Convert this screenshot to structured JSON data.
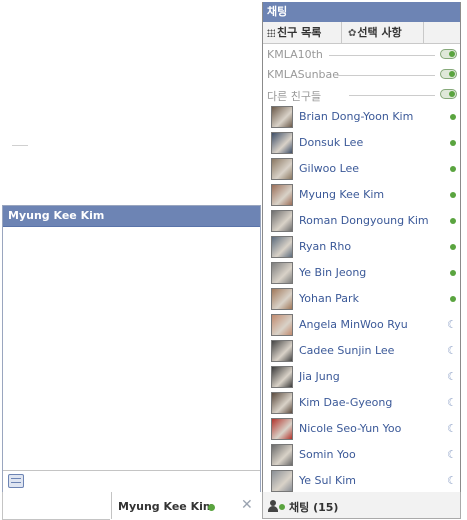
{
  "buddy_list": {
    "title": "채팅",
    "toolbar": {
      "friends_list_label": "친구 목록",
      "options_label": "선택 사항"
    },
    "groups": [
      {
        "label": "KMLA10th",
        "enabled": true
      },
      {
        "label": "KMLASunbae",
        "enabled": true
      },
      {
        "label": "다른 친구들",
        "enabled": true
      }
    ],
    "friends": [
      {
        "name": "Brian Dong-Yoon Kim",
        "status": "online",
        "avatar_color": "#6b5a4a"
      },
      {
        "name": "Donsuk Lee",
        "status": "online",
        "avatar_color": "#3d4e67"
      },
      {
        "name": "Gilwoo Lee",
        "status": "online",
        "avatar_color": "#8a7862"
      },
      {
        "name": "Myung Kee Kim",
        "status": "online",
        "avatar_color": "#9a6e58"
      },
      {
        "name": "Roman Dongyoung Kim",
        "status": "online",
        "avatar_color": "#6e6e6e"
      },
      {
        "name": "Ryan Rho",
        "status": "online",
        "avatar_color": "#5c6b7c"
      },
      {
        "name": "Ye Bin Jeong",
        "status": "online",
        "avatar_color": "#7d7d7d"
      },
      {
        "name": "Yohan Park",
        "status": "online",
        "avatar_color": "#a0785a"
      },
      {
        "name": "Angela MinWoo Ryu",
        "status": "idle",
        "avatar_color": "#c08a6e"
      },
      {
        "name": "Cadee Sunjin Lee",
        "status": "idle",
        "avatar_color": "#444444"
      },
      {
        "name": "Jia Jung",
        "status": "idle",
        "avatar_color": "#3a3a3a"
      },
      {
        "name": "Kim Dae-Gyeong",
        "status": "idle",
        "avatar_color": "#5a4a3e"
      },
      {
        "name": "Nicole Seo-Yun Yoo",
        "status": "idle",
        "avatar_color": "#b2342c"
      },
      {
        "name": "Somin Yoo",
        "status": "idle",
        "avatar_color": "#6a6a6a"
      },
      {
        "name": "Ye Sul Kim",
        "status": "idle",
        "avatar_color": "#8a8f96"
      }
    ]
  },
  "conversation": {
    "header_name": "Myung Kee Kim"
  },
  "bottom_bar": {
    "tab_name": "Myung Kee Kim",
    "tab_status": "online",
    "close_glyph": "✕",
    "chat_button_label": "채팅 (15)"
  },
  "colors": {
    "header_blue": "#6d84b4",
    "link_blue": "#3b5998",
    "online_green": "#5aa43f",
    "idle_blue": "#8ea1c7"
  },
  "icons": {
    "grid": "grid-icon",
    "gear": "gear-icon",
    "moon": "moon-icon",
    "people": "people-icon",
    "emoticon": "emoticon-icon",
    "close": "close-icon"
  }
}
